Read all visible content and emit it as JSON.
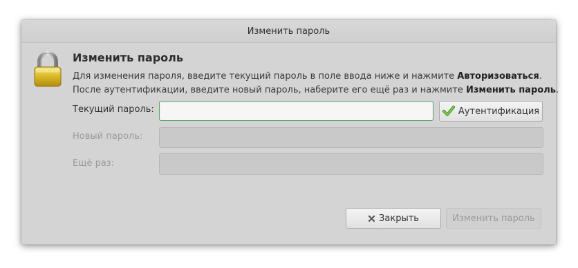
{
  "window": {
    "title": "Изменить пароль"
  },
  "icons": {
    "lock": "lock-icon",
    "check": "check-icon",
    "close": "close-icon"
  },
  "dialog": {
    "heading": "Изменить пароль",
    "desc_line1_text": "Для изменения пароля, введите текущий пароль в поле ввода ниже и нажмите ",
    "desc_line1_bold": "Авторизоваться",
    "desc_line1_end": ".",
    "desc_line2_text": "После аутентификации, введите новый пароль, наберите его ещё раз и нажмите ",
    "desc_line2_bold": "Изменить пароль",
    "desc_line2_end": "."
  },
  "form": {
    "current_label": "Текущий пароль:",
    "current_value": "",
    "new_label": "Новый пароль:",
    "repeat_label": "Ещё раз:",
    "auth_button": "Аутентификация"
  },
  "footer": {
    "close_button": "Закрыть",
    "change_button": "Изменить пароль"
  },
  "colors": {
    "focus_border": "#5aa36b",
    "dialog_bg": "#d4d4d4",
    "check_green": "#4fa22a"
  }
}
